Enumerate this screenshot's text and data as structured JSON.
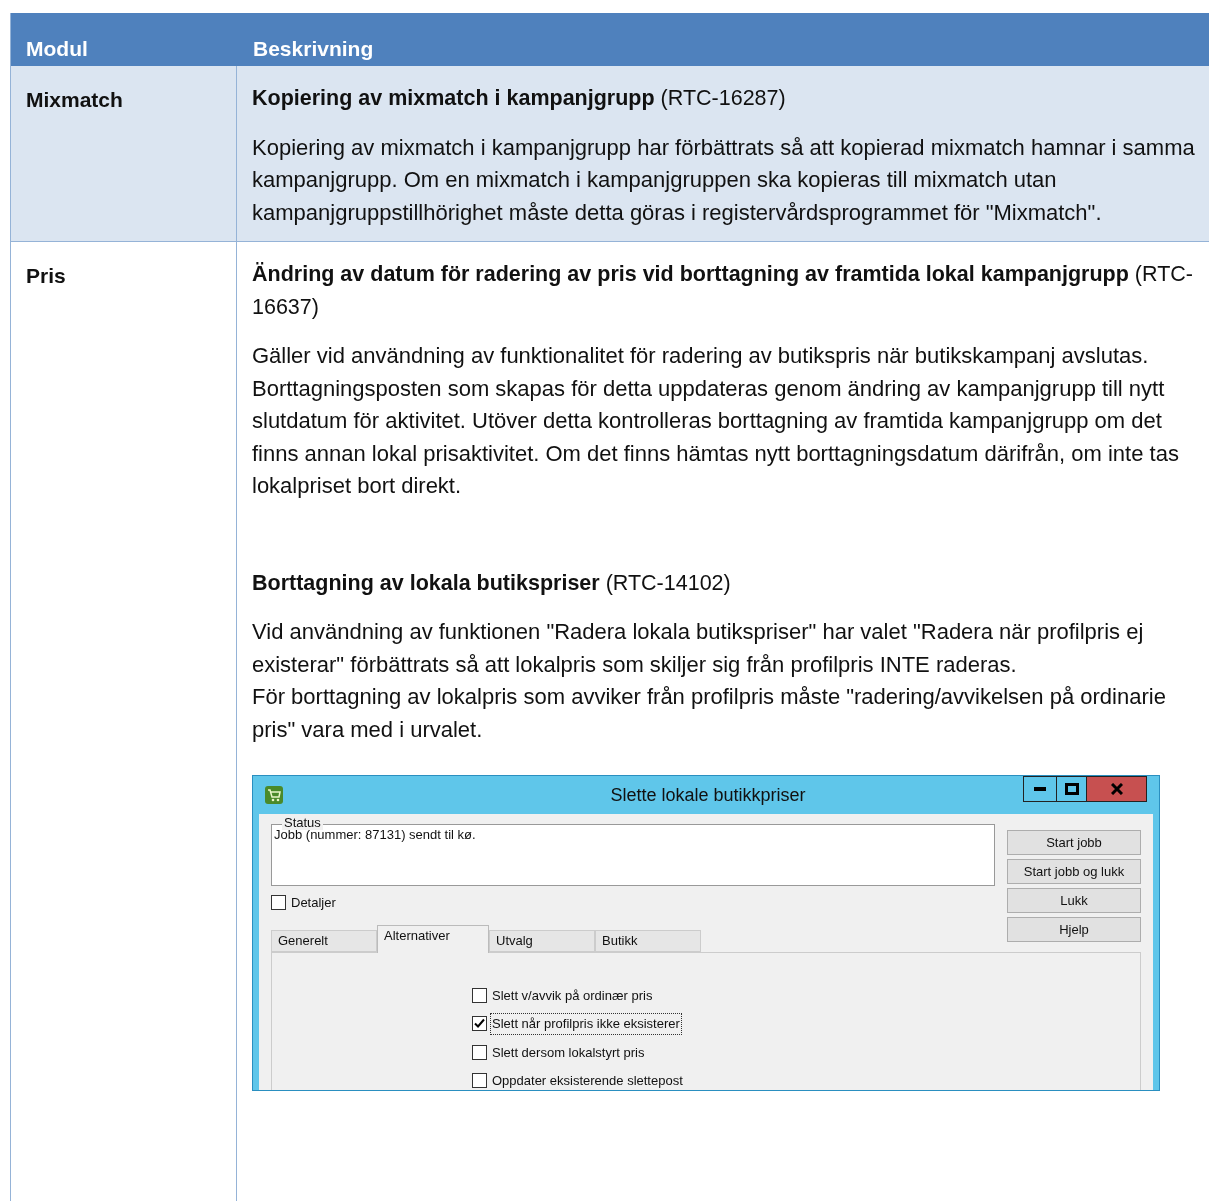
{
  "table": {
    "columns": [
      "Modul",
      "Beskrivning"
    ],
    "rows": [
      {
        "module": "Mixmatch",
        "entries": [
          {
            "title": "Kopiering av mixmatch i kampanjgrupp",
            "ref": "(RTC-16287)",
            "paragraphs": [
              "Kopiering av mixmatch i kampanjgrupp har förbättrats så att kopierad mixmatch hamnar i samma kampanjgrupp. Om en mixmatch i kampanjgruppen ska kopieras till mixmatch utan kampanjgruppstillhörighet måste detta göras i registervårdsprogrammet för \"Mixmatch\"."
            ]
          }
        ]
      },
      {
        "module": "Pris",
        "entries": [
          {
            "title": "Ändring av datum för radering av pris vid borttagning av framtida lokal kampanjgrupp",
            "ref": "(RTC-16637)",
            "paragraphs": [
              "Gäller vid användning av funktionalitet för radering av butikspris när butikskampanj avslutas. Borttagningsposten som skapas för detta uppdateras genom ändring av kampanjgrupp till nytt slutdatum för aktivitet. Utöver detta kontrolleras borttagning av framtida kampanjgrupp om det finns annan lokal prisaktivitet. Om det finns hämtas nytt borttagningsdatum därifrån, om inte tas lokalpriset bort direkt."
            ]
          },
          {
            "title": "Borttagning av lokala butikspriser",
            "ref": "(RTC-14102)",
            "paragraphs": [
              "Vid användning av funktionen \"Radera lokala butikspriser\" har valet \"Radera när profilpris ej existerar\" förbättrats så att lokalpris som skiljer sig från profilpris INTE raderas.",
              "För borttagning av lokalpris som avviker från profilpris måste \"radering/avvikelsen på ordinarie pris\" vara med i urvalet."
            ],
            "dialog": {
              "title": "Slette lokale butikkpriser",
              "status_label": "Status",
              "status_text": "Jobb (nummer: 87131) sendt til kø.",
              "details": {
                "label": "Detaljer",
                "checked": false
              },
              "buttons": [
                "Start jobb",
                "Start jobb og lukk",
                "Lukk",
                "Hjelp"
              ],
              "tabs": [
                {
                  "label": "Generelt",
                  "selected": false
                },
                {
                  "label": "Alternativer",
                  "selected": true
                },
                {
                  "label": "Utvalg",
                  "selected": false
                },
                {
                  "label": "Butikk",
                  "selected": false
                }
              ],
              "options": [
                {
                  "label": "Slett v/avvik på ordinær pris",
                  "checked": false,
                  "focused": false
                },
                {
                  "label": "Slett når profilpris ikke eksisterer",
                  "checked": true,
                  "focused": true
                },
                {
                  "label": "Slett dersom lokalstyrt pris",
                  "checked": false,
                  "focused": false
                },
                {
                  "label": "Oppdater eksisterende slettepost",
                  "checked": false,
                  "focused": false
                }
              ]
            }
          }
        ]
      }
    ]
  }
}
